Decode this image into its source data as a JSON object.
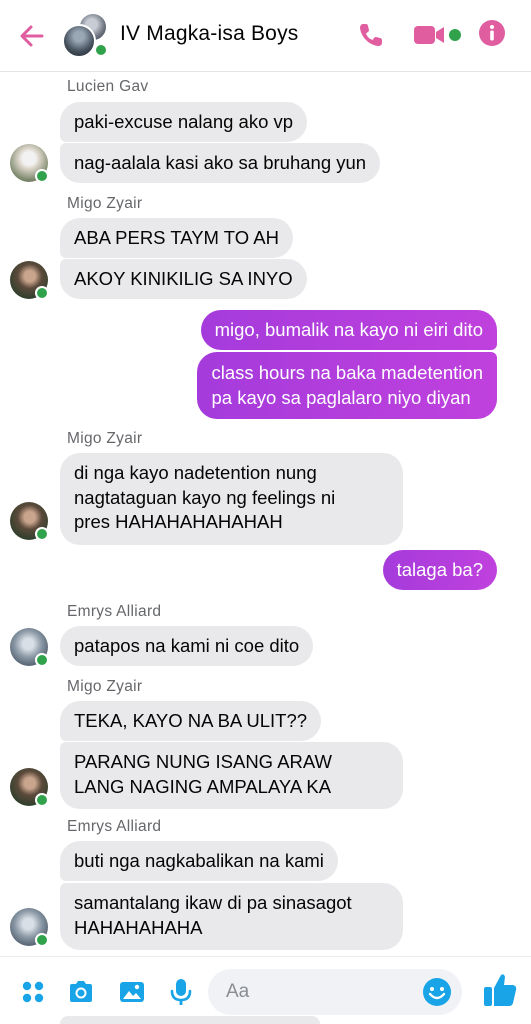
{
  "header": {
    "title": "IV Magka-isa Boys",
    "icons": {
      "back": "back-arrow-icon",
      "call": "phone-icon",
      "video": "video-camera-icon",
      "info": "info-icon"
    },
    "accent_color": "#e05ea0",
    "online_color": "#31a24c"
  },
  "messages": {
    "s1": "Lucien Gav",
    "m1": "paki-excuse nalang ako vp",
    "m2": "nag-aalala kasi ako sa bruhang yun",
    "s2": "Migo Zyair",
    "m3": "ABA PERS TAYM TO AH",
    "m4": "AKOY KINIKILIG SA INYO",
    "o1": "migo, bumalik na kayo ni eiri dito",
    "o2_l1": "class hours na baka madetention",
    "o2_l2": "pa kayo sa paglalaro niyo diyan",
    "s3": "Migo Zyair",
    "m5_l1": "di nga kayo nadetention nung",
    "m5_l2": "nagtataguan kayo ng feelings ni",
    "m5_l3": "pres HAHAHAHAHAHAH",
    "o3": "talaga ba?",
    "s4": "Emrys Alliard",
    "m6": "patapos na kami ni coe dito",
    "s5": "Migo Zyair",
    "m7": "TEKA, KAYO NA BA ULIT??",
    "m8_l1": "PARANG NUNG ISANG ARAW",
    "m8_l2": "LANG NAGING AMPALAYA KA",
    "s6": "Emrys Alliard",
    "m9": "buti nga nagkabalikan na kami",
    "m10_l1": "samantalang ikaw di pa sinasagot",
    "m10_l2": "HAHAHAHAHA"
  },
  "composer": {
    "placeholder": "Aa",
    "icons": [
      "menu-dots-icon",
      "camera-icon",
      "gallery-icon",
      "microphone-icon",
      "emoji-icon",
      "like-icon"
    ],
    "tool_color": "#1aa4e8"
  },
  "colors": {
    "incoming_bubble": "#e9e9eb",
    "outgoing_bubble_start": "#a53bdc",
    "outgoing_bubble_end": "#c041dd"
  }
}
